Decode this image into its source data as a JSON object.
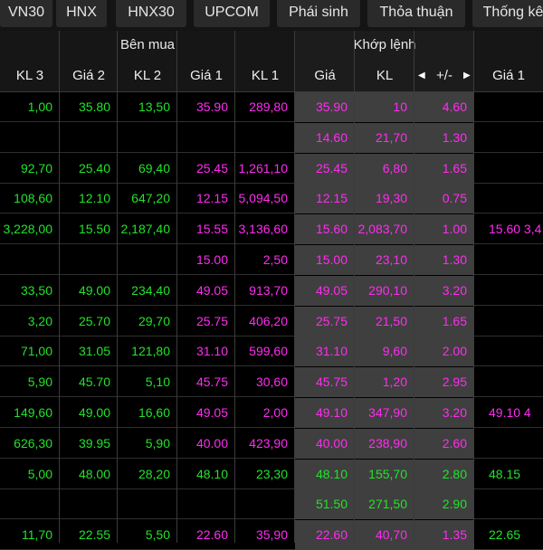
{
  "colors": {
    "green": "#22e22a",
    "magenta": "#ff2cf0",
    "match_bg": "#3f3f3f"
  },
  "tabs": [
    "VN30",
    "HNX",
    "HNX30",
    "UPCOM",
    "Phái sinh",
    "Thỏa thuận",
    "Thống kê"
  ],
  "header": {
    "buy_group": "Bên mua",
    "match_group": "Khớp lệnh",
    "columns": [
      "KL 3",
      "Giá 2",
      "KL 2",
      "Giá 1",
      "KL 1",
      "Giá",
      "KL",
      "+/-",
      "Giá 1"
    ],
    "prev_icon": "arrow-left-icon",
    "next_icon": "arrow-right-icon"
  },
  "rows": [
    {
      "kl3": "1,00",
      "gia2": "35.80",
      "kl2": "13,50",
      "gia1": "35.90",
      "kl1": "289,80",
      "gia": "35.90",
      "kl": "10",
      "chg": "4.60",
      "ask1": ""
    },
    {
      "kl3": "",
      "gia2": "",
      "kl2": "",
      "gia1": "",
      "kl1": "",
      "gia": "14.60",
      "kl": "21,70",
      "chg": "1.30",
      "ask1": ""
    },
    {
      "kl3": "92,70",
      "gia2": "25.40",
      "kl2": "69,40",
      "gia1": "25.45",
      "kl1": "1,261,10",
      "gia": "25.45",
      "kl": "6,80",
      "chg": "1.65",
      "ask1": ""
    },
    {
      "kl3": "108,60",
      "gia2": "12.10",
      "kl2": "647,20",
      "gia1": "12.15",
      "kl1": "5,094,50",
      "gia": "12.15",
      "kl": "19,30",
      "chg": "0.75",
      "ask1": ""
    },
    {
      "kl3": "3,228,00",
      "gia2": "15.50",
      "kl2": "2,187,40",
      "gia1": "15.55",
      "kl1": "3,136,60",
      "gia": "15.60",
      "kl": "2,083,70",
      "chg": "1.00",
      "ask1": "15.60 3,4"
    },
    {
      "kl3": "",
      "gia2": "",
      "kl2": "",
      "gia1": "15.00",
      "kl1": "2,50",
      "gia": "15.00",
      "kl": "23,10",
      "chg": "1.30",
      "ask1": ""
    },
    {
      "kl3": "33,50",
      "gia2": "49.00",
      "kl2": "234,40",
      "gia1": "49.05",
      "kl1": "913,70",
      "gia": "49.05",
      "kl": "290,10",
      "chg": "3.20",
      "ask1": ""
    },
    {
      "kl3": "3,20",
      "gia2": "25.70",
      "kl2": "29,70",
      "gia1": "25.75",
      "kl1": "406,20",
      "gia": "25.75",
      "kl": "21,50",
      "chg": "1.65",
      "ask1": ""
    },
    {
      "kl3": "71,00",
      "gia2": "31.05",
      "kl2": "121,80",
      "gia1": "31.10",
      "kl1": "599,60",
      "gia": "31.10",
      "kl": "9,60",
      "chg": "2.00",
      "ask1": ""
    },
    {
      "kl3": "5,90",
      "gia2": "45.70",
      "kl2": "5,10",
      "gia1": "45.75",
      "kl1": "30,60",
      "gia": "45.75",
      "kl": "1,20",
      "chg": "2.95",
      "ask1": ""
    },
    {
      "kl3": "149,60",
      "gia2": "49.00",
      "kl2": "16,60",
      "gia1": "49.05",
      "kl1": "2,00",
      "gia": "49.10",
      "kl": "347,90",
      "chg": "3.20",
      "ask1": "49.10 4"
    },
    {
      "kl3": "626,30",
      "gia2": "39.95",
      "kl2": "5,90",
      "gia1": "40.00",
      "kl1": "423,90",
      "gia": "40.00",
      "kl": "238,90",
      "chg": "2.60",
      "ask1": ""
    },
    {
      "kl3": "5,00",
      "gia2": "48.00",
      "kl2": "28,20",
      "gia1": "48.10",
      "kl1": "23,30",
      "gia": "48.10",
      "kl": "155,70",
      "chg": "2.80",
      "ask1": "48.15"
    },
    {
      "kl3": "",
      "gia2": "",
      "kl2": "",
      "gia1": "",
      "kl1": "",
      "gia": "51.50",
      "kl": "271,50",
      "chg": "2.90",
      "ask1": ""
    },
    {
      "kl3": "11,70",
      "gia2": "22.55",
      "kl2": "5,50",
      "gia1": "22.60",
      "kl1": "35,90",
      "gia": "22.60",
      "kl": "40,70",
      "chg": "1.35",
      "ask1": "22.65"
    }
  ]
}
